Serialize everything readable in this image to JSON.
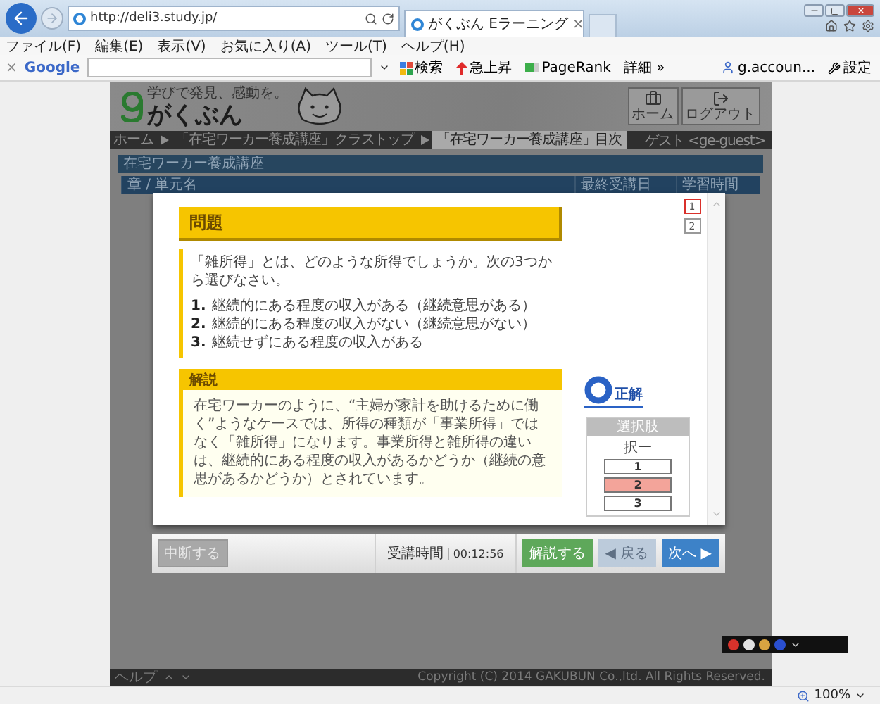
{
  "browser": {
    "url": "http://deli3.study.jp/",
    "tab_title": "がくぶん Eラーニング",
    "tab_close": "×",
    "menu": [
      "ファイル(F)",
      "編集(E)",
      "表示(V)",
      "お気に入り(A)",
      "ツール(T)",
      "ヘルプ(H)"
    ],
    "toolbar": {
      "close": "×",
      "logo": "Google",
      "buttons": [
        {
          "kind": "search",
          "label": "検索"
        },
        {
          "kind": "trend",
          "label": "急上昇"
        },
        {
          "kind": "rank",
          "label": "PageRank"
        }
      ],
      "more": "詳細 »",
      "account": "g.accoun...",
      "settings": "設定"
    }
  },
  "site": {
    "tagline": "学びで発見、感動を。",
    "logo": "がくぶん",
    "header_buttons": [
      {
        "kind": "home",
        "label": "ホーム"
      },
      {
        "kind": "logout",
        "label": "ログアウト"
      }
    ],
    "breadcrumb": [
      {
        "label": "ホーム",
        "selected": false
      },
      {
        "label": "「在宅ワーカー養成講座」クラストップ",
        "selected": false
      },
      {
        "label": "「在宅ワーカー養成講座」目次",
        "selected": true
      }
    ],
    "user": "ゲスト <ge-guest>",
    "course_title": "在宅ワーカー養成講座",
    "table": {
      "columns": [
        "章 / 単元名",
        "最終受講日",
        "学習時間"
      ]
    },
    "footer": {
      "help": "ヘルプ",
      "copyright": "Copyright (C) 2014 GAKUBUN Co.,ltd. All Rights Reserved."
    }
  },
  "modal": {
    "question": {
      "title": "問題",
      "text": "「雑所得」とは、どのような所得でしょうか。次の3つから選びなさい。",
      "options": [
        {
          "number": "1.",
          "text": "継続的にある程度の収入がある（継続意思がある）"
        },
        {
          "number": "2.",
          "text": "継続的にある程度の収入がない（継続意思がない）"
        },
        {
          "number": "3.",
          "text": "継続せずにある程度の収入がある"
        }
      ]
    },
    "explanation": {
      "title": "解説",
      "text": "在宅ワーカーのように、“主婦が家計を助けるために働く”ようなケースでは、所得の種類が「事業所得」ではなく「雑所得」になります。事業所得と雑所得の違いは、継続的にある程度の収入があるかどうか（継続の意思があるかどうか）とされています。"
    },
    "pages": [
      {
        "label": "1",
        "selected": true
      },
      {
        "label": "2",
        "selected": false
      }
    ],
    "result": "正解",
    "choices": {
      "title": "選択肢",
      "type": "択一",
      "options": [
        {
          "label": "1",
          "selected": false
        },
        {
          "label": "2",
          "selected": true
        },
        {
          "label": "3",
          "selected": false
        }
      ]
    },
    "footer": {
      "suspend": "中断する",
      "time_label": "受講時間",
      "time": "00:12:56",
      "buttons": [
        {
          "kind": "action",
          "label": "解説する",
          "disabled": false
        },
        {
          "kind": "nav",
          "label": "◀ 戻る",
          "disabled": true
        },
        {
          "kind": "nav",
          "label": "次へ ▶",
          "disabled": false
        }
      ]
    }
  },
  "status_bar": {
    "zoom": "100%"
  }
}
